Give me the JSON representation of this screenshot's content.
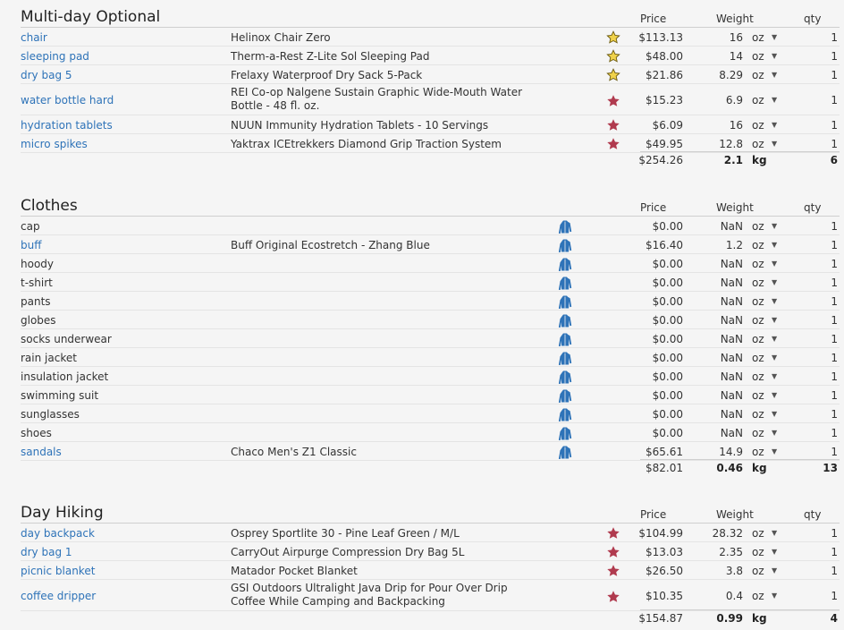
{
  "colors": {
    "link": "#2e73b8",
    "star_gold": "#e8c640",
    "star_red": "#b03a4e",
    "shirt_blue": "#2e73b8"
  },
  "categories": [
    {
      "title": "Multi-day Optional",
      "headers": {
        "price": "Price",
        "weight": "Weight",
        "qty": "qty"
      },
      "items": [
        {
          "name": "chair",
          "link": true,
          "desc": "Helinox Chair Zero",
          "icon": "gold-star-icon",
          "price": "$113.13",
          "weight": "16",
          "unit": "oz",
          "qty": "1"
        },
        {
          "name": "sleeping pad",
          "link": true,
          "desc": "Therm-a-Rest Z-Lite Sol Sleeping Pad",
          "icon": "gold-star-icon",
          "price": "$48.00",
          "weight": "14",
          "unit": "oz",
          "qty": "1"
        },
        {
          "name": "dry bag 5",
          "link": true,
          "desc": "Frelaxy Waterproof Dry Sack 5-Pack",
          "icon": "gold-star-icon",
          "price": "$21.86",
          "weight": "8.29",
          "unit": "oz",
          "qty": "1"
        },
        {
          "name": "water bottle hard",
          "link": true,
          "desc": "REI Co-op Nalgene Sustain Graphic Wide-Mouth Water Bottle - 48 fl. oz.",
          "tall": true,
          "icon": "red-star-icon",
          "price": "$15.23",
          "weight": "6.9",
          "unit": "oz",
          "qty": "1"
        },
        {
          "name": "hydration tablets",
          "link": true,
          "desc": "NUUN Immunity Hydration Tablets - 10 Servings",
          "icon": "red-star-icon",
          "price": "$6.09",
          "weight": "16",
          "unit": "oz",
          "qty": "1"
        },
        {
          "name": "micro spikes",
          "link": true,
          "desc": "Yaktrax ICEtrekkers Diamond Grip Traction System",
          "icon": "red-star-icon",
          "price": "$49.95",
          "weight": "12.8",
          "unit": "oz",
          "qty": "1"
        }
      ],
      "total": {
        "price": "$254.26",
        "weight": "2.1",
        "unit": "kg",
        "qty": "6"
      }
    },
    {
      "title": "Clothes",
      "headers": {
        "price": "Price",
        "weight": "Weight",
        "qty": "qty"
      },
      "items": [
        {
          "name": "cap",
          "link": false,
          "desc": "",
          "icon": "shirt-icon",
          "price": "$0.00",
          "weight": "NaN",
          "unit": "oz",
          "qty": "1"
        },
        {
          "name": "buff",
          "link": true,
          "desc": "Buff Original Ecostretch - Zhang Blue",
          "icon": "shirt-icon",
          "price": "$16.40",
          "weight": "1.2",
          "unit": "oz",
          "qty": "1"
        },
        {
          "name": "hoody",
          "link": false,
          "desc": "",
          "icon": "shirt-icon",
          "price": "$0.00",
          "weight": "NaN",
          "unit": "oz",
          "qty": "1"
        },
        {
          "name": "t-shirt",
          "link": false,
          "desc": "",
          "icon": "shirt-icon",
          "price": "$0.00",
          "weight": "NaN",
          "unit": "oz",
          "qty": "1"
        },
        {
          "name": "pants",
          "link": false,
          "desc": "",
          "icon": "shirt-icon",
          "price": "$0.00",
          "weight": "NaN",
          "unit": "oz",
          "qty": "1"
        },
        {
          "name": "globes",
          "link": false,
          "desc": "",
          "icon": "shirt-icon",
          "price": "$0.00",
          "weight": "NaN",
          "unit": "oz",
          "qty": "1"
        },
        {
          "name": "socks underwear",
          "link": false,
          "desc": "",
          "icon": "shirt-icon",
          "price": "$0.00",
          "weight": "NaN",
          "unit": "oz",
          "qty": "1"
        },
        {
          "name": "rain jacket",
          "link": false,
          "desc": "",
          "icon": "shirt-icon",
          "price": "$0.00",
          "weight": "NaN",
          "unit": "oz",
          "qty": "1"
        },
        {
          "name": "insulation jacket",
          "link": false,
          "desc": "",
          "icon": "shirt-icon",
          "price": "$0.00",
          "weight": "NaN",
          "unit": "oz",
          "qty": "1"
        },
        {
          "name": "swimming suit",
          "link": false,
          "desc": "",
          "icon": "shirt-icon",
          "price": "$0.00",
          "weight": "NaN",
          "unit": "oz",
          "qty": "1"
        },
        {
          "name": "sunglasses",
          "link": false,
          "desc": "",
          "icon": "shirt-icon",
          "price": "$0.00",
          "weight": "NaN",
          "unit": "oz",
          "qty": "1"
        },
        {
          "name": "shoes",
          "link": false,
          "desc": "",
          "icon": "shirt-icon",
          "price": "$0.00",
          "weight": "NaN",
          "unit": "oz",
          "qty": "1"
        },
        {
          "name": "sandals",
          "link": true,
          "desc": "Chaco Men's Z1 Classic",
          "icon": "shirt-icon",
          "price": "$65.61",
          "weight": "14.9",
          "unit": "oz",
          "qty": "1"
        }
      ],
      "total": {
        "price": "$82.01",
        "weight": "0.46",
        "unit": "kg",
        "qty": "13"
      }
    },
    {
      "title": "Day Hiking",
      "headers": {
        "price": "Price",
        "weight": "Weight",
        "qty": "qty"
      },
      "items": [
        {
          "name": "day backpack",
          "link": true,
          "desc": "Osprey Sportlite 30 - Pine Leaf Green / M/L",
          "icon": "red-star-icon",
          "price": "$104.99",
          "weight": "28.32",
          "unit": "oz",
          "qty": "1"
        },
        {
          "name": "dry bag 1",
          "link": true,
          "desc": "CarryOut Airpurge Compression Dry Bag 5L",
          "icon": "red-star-icon",
          "price": "$13.03",
          "weight": "2.35",
          "unit": "oz",
          "qty": "1"
        },
        {
          "name": "picnic blanket",
          "link": true,
          "desc": "Matador Pocket Blanket",
          "icon": "red-star-icon",
          "price": "$26.50",
          "weight": "3.8",
          "unit": "oz",
          "qty": "1"
        },
        {
          "name": "coffee dripper",
          "link": true,
          "desc": "GSI Outdoors Ultralight Java Drip for Pour Over Drip Coffee While Camping and Backpacking",
          "tall": true,
          "icon": "red-star-icon",
          "price": "$10.35",
          "weight": "0.4",
          "unit": "oz",
          "qty": "1"
        }
      ],
      "total": {
        "price": "$154.87",
        "weight": "0.99",
        "unit": "kg",
        "qty": "4"
      }
    }
  ]
}
